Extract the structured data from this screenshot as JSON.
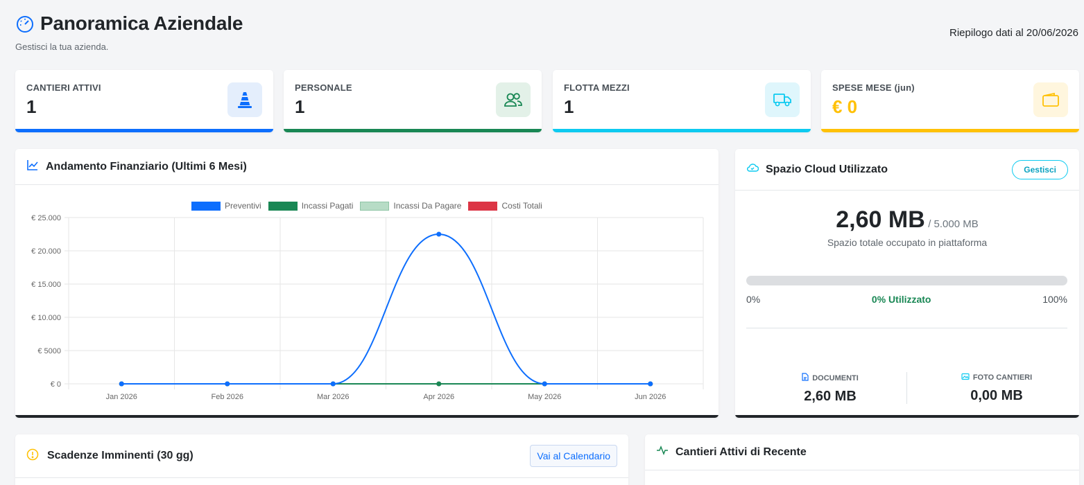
{
  "header": {
    "title": "Panoramica Aziendale",
    "subtitle": "Gestisci la tua azienda.",
    "summary_date": "Riepilogo dati al 20/06/2026"
  },
  "kpis": [
    {
      "label": "CANTIERI ATTIVI",
      "value": "1",
      "color": "#0d6efd",
      "icon": "traffic-cone-icon"
    },
    {
      "label": "PERSONALE",
      "value": "1",
      "color": "#198754",
      "icon": "people-icon"
    },
    {
      "label": "FLOTTA MEZZI",
      "value": "1",
      "color": "#0dcaf0",
      "icon": "truck-icon"
    },
    {
      "label": "SPESE MESE (jun)",
      "value": "€ 0",
      "color": "#ffc107",
      "icon": "wallet-icon"
    }
  ],
  "finance": {
    "title": "Andamento Finanziario (Ultimi 6 Mesi)"
  },
  "chart_data": {
    "type": "line",
    "categories": [
      "Jan 2026",
      "Feb 2026",
      "Mar 2026",
      "Apr 2026",
      "May 2026",
      "Jun 2026"
    ],
    "series": [
      {
        "name": "Preventivi",
        "values": [
          0,
          0,
          0,
          22500,
          0,
          0
        ],
        "color": "#0d6efd"
      },
      {
        "name": "Incassi Pagati",
        "values": [
          0,
          0,
          0,
          0,
          0,
          0
        ],
        "color": "#198754"
      },
      {
        "name": "Incassi Da Pagare",
        "values": [
          0,
          0,
          0,
          0,
          0,
          0
        ],
        "color": "#b7dcc6"
      },
      {
        "name": "Costi Totali",
        "values": [
          0,
          0,
          0,
          0,
          0,
          0
        ],
        "color": "#dc3545"
      }
    ],
    "ylim": [
      0,
      25000
    ],
    "yticks": [
      "€ 0",
      "€ 5000",
      "€ 10.000",
      "€ 15.000",
      "€ 20.000",
      "€ 25.000"
    ],
    "grid": true,
    "legend": "top"
  },
  "cloud": {
    "title": "Spazio Cloud Utilizzato",
    "manage_label": "Gestisci",
    "used": "2,60 MB",
    "total": "/ 5.000 MB",
    "caption": "Spazio totale occupato in piattaforma",
    "progress_percent": 0,
    "min_label": "0%",
    "mid_label": "0% Utilizzato",
    "max_label": "100%",
    "documents_label": "DOCUMENTI",
    "documents_value": "2,60 MB",
    "photos_label": "FOTO CANTIERI",
    "photos_value": "0,00 MB"
  },
  "deadlines": {
    "title": "Scadenze Imminenti (30 gg)",
    "calendar_label": "Vai al Calendario"
  },
  "recent": {
    "title": "Cantieri Attivi di Recente"
  }
}
